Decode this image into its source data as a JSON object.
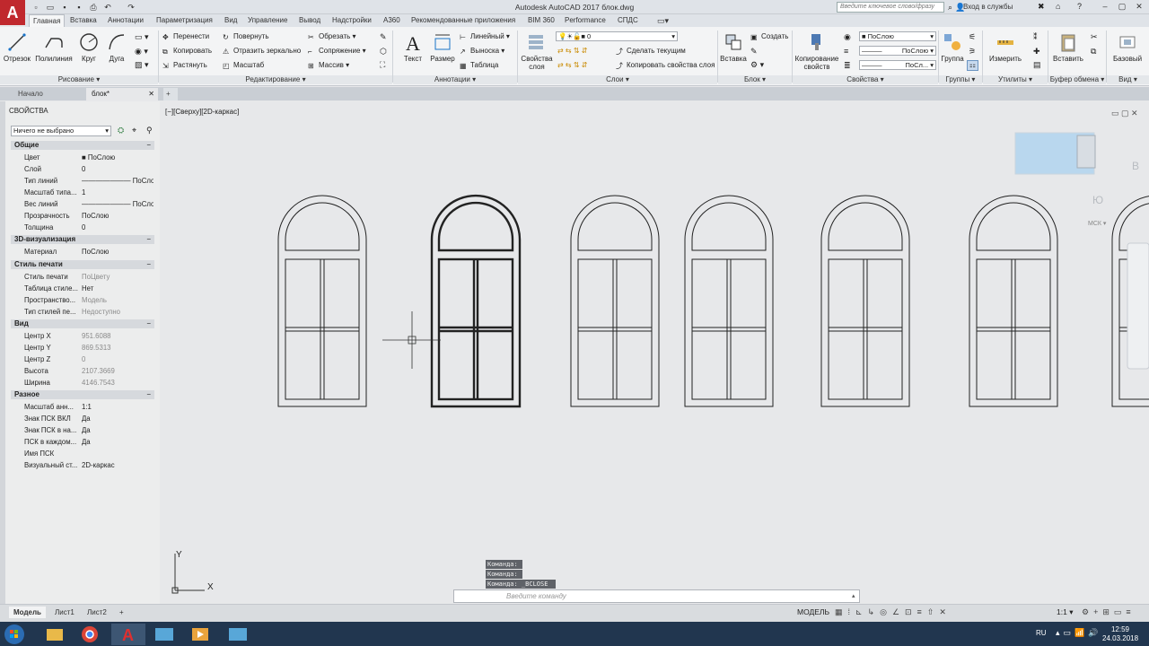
{
  "window": {
    "title": "Autodesk AutoCAD 2017   блок.dwg",
    "logo": "A",
    "search_placeholder": "Введите ключевое слово/фразу",
    "login": "Вход в службы"
  },
  "ribbon_tabs": [
    "Главная",
    "Вставка",
    "Аннотации",
    "Параметризация",
    "Вид",
    "Управление",
    "Вывод",
    "Надстройки",
    "A360",
    "Рекомендованные приложения",
    "BIM 360",
    "Performance",
    "СПДС"
  ],
  "ribbon": {
    "draw": {
      "otrezok": "Отрезок",
      "polyline": "Полилиния",
      "circle": "Круг",
      "arc": "Дуга",
      "label": "Рисование"
    },
    "modify": {
      "move": "Перенести",
      "copy": "Копировать",
      "stretch": "Растянуть",
      "rotate": "Повернуть",
      "mirror": "Отразить зеркально",
      "scale": "Масштаб",
      "trim": "Обрезать",
      "fillet": "Сопряжение",
      "array": "Массив",
      "label": "Редактирование"
    },
    "annot": {
      "text": "Текст",
      "dim": "Размер",
      "linear": "Линейный",
      "leader": "Выноска",
      "table": "Таблица",
      "label": "Аннотации"
    },
    "layers": {
      "props": "Свойства слоя",
      "current": "0",
      "make_current": "Сделать текущим",
      "copy_props": "Копировать свойства слоя",
      "label": "Слои"
    },
    "block": {
      "insert": "Вставка",
      "create": "Создать",
      "label": "Блок"
    },
    "properties": {
      "copy": "Копирование свойств",
      "color": "ПоСлою",
      "linetype": "ПоСлою",
      "lineweight": "ПоСл...",
      "label": "Свойства"
    },
    "groups": {
      "group": "Группа",
      "label": "Группы"
    },
    "utils": {
      "measure": "Измерить",
      "label": "Утилиты"
    },
    "clipboard": {
      "paste": "Вставить",
      "label": "Буфер обмена"
    },
    "view": {
      "base": "Базовый",
      "label": "Вид"
    }
  },
  "doc_tabs": {
    "start": "Начало",
    "current": "блок*"
  },
  "properties": {
    "title": "СВОЙСТВА",
    "selection": "Ничего не выбрано",
    "general": {
      "title": "Общие",
      "rows": [
        {
          "n": "Цвет",
          "v": "ПоСлою"
        },
        {
          "n": "Слой",
          "v": "0"
        },
        {
          "n": "Тип линий",
          "v": "ПоСлою"
        },
        {
          "n": "Масштаб типа...",
          "v": "1"
        },
        {
          "n": "Вес линий",
          "v": "ПоСлою"
        },
        {
          "n": "Прозрачность",
          "v": "ПоСлою"
        },
        {
          "n": "Толщина",
          "v": "0"
        }
      ]
    },
    "viz3d": {
      "title": "3D-визуализация",
      "rows": [
        {
          "n": "Материал",
          "v": "ПоСлою"
        }
      ]
    },
    "plot": {
      "title": "Стиль печати",
      "rows": [
        {
          "n": "Стиль печати",
          "v": "ПоЦвету"
        },
        {
          "n": "Таблица стиле...",
          "v": "Нет"
        },
        {
          "n": "Пространство...",
          "v": "Модель"
        },
        {
          "n": "Тип стилей пе...",
          "v": "Недоступно"
        }
      ]
    },
    "view": {
      "title": "Вид",
      "rows": [
        {
          "n": "Центр X",
          "v": "951.6088"
        },
        {
          "n": "Центр Y",
          "v": "869.5313"
        },
        {
          "n": "Центр Z",
          "v": "0"
        },
        {
          "n": "Высота",
          "v": "2107.3669"
        },
        {
          "n": "Ширина",
          "v": "4146.7543"
        }
      ]
    },
    "misc": {
      "title": "Разное",
      "rows": [
        {
          "n": "Масштаб анн...",
          "v": "1:1"
        },
        {
          "n": "Знак ПСК ВКЛ",
          "v": "Да"
        },
        {
          "n": "Знак ПСК в на...",
          "v": "Да"
        },
        {
          "n": "ПСК в каждом...",
          "v": "Да"
        },
        {
          "n": "Имя ПСК",
          "v": ""
        },
        {
          "n": "Визуальный ст...",
          "v": "2D-каркас"
        }
      ]
    }
  },
  "viewport": {
    "label": "[−][Сверху][2D-каркас]",
    "viewcube_s": "Ю",
    "viewcube_w": "В",
    "ucs": "МСК",
    "axis_x": "X",
    "axis_y": "Y"
  },
  "command": {
    "history": [
      "Команда:",
      "Команда:",
      "Команда: _BCLOSE"
    ],
    "placeholder": "Введите команду"
  },
  "layout_tabs": [
    "Модель",
    "Лист1",
    "Лист2"
  ],
  "status": {
    "model": "МОДЕЛЬ",
    "scale": "1:1"
  },
  "taskbar": {
    "lang": "RU",
    "time": "12:59",
    "date": "24.03.2018"
  }
}
